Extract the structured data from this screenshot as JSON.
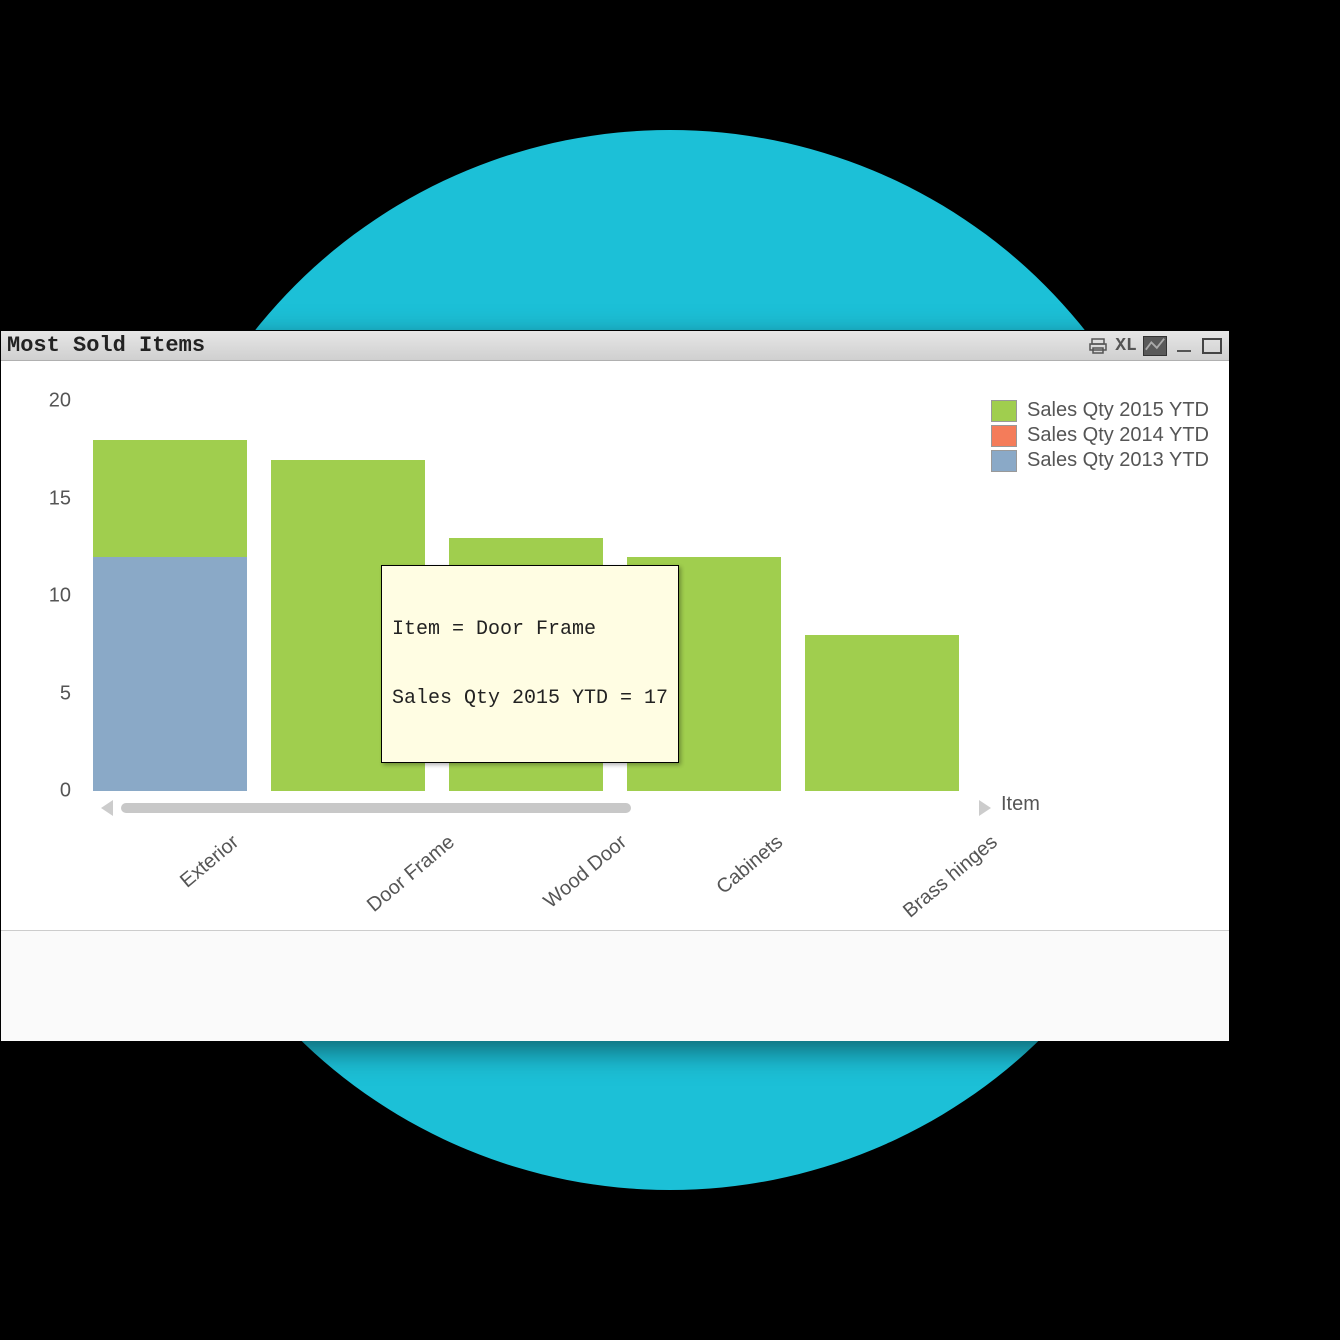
{
  "window": {
    "title": "Most Sold Items"
  },
  "toolbar_icons": [
    "print-icon",
    "xl-icon",
    "chart-type-icon",
    "minimize-icon",
    "maximize-icon"
  ],
  "xl_label": "XL",
  "axis": {
    "xlabel": "Item"
  },
  "y_ticks": [
    "0",
    "5",
    "10",
    "15",
    "20"
  ],
  "legend": {
    "items": [
      {
        "label": "Sales Qty 2015 YTD"
      },
      {
        "label": "Sales Qty 2014 YTD"
      },
      {
        "label": "Sales Qty 2013 YTD"
      }
    ]
  },
  "tooltip": {
    "line1": "Item = Door Frame",
    "line2": "Sales Qty 2015 YTD = 17"
  },
  "categories": [
    "Exterior",
    "Door Frame",
    "Wood Door",
    "Cabinets",
    "Brass hinges"
  ],
  "colors": {
    "s2015": "#a0ce4e",
    "s2014": "#f47c5a",
    "s2013": "#8aa9c7"
  },
  "chart_data": {
    "type": "bar",
    "title": "Most Sold Items",
    "xlabel": "Item",
    "ylabel": "",
    "ylim": [
      0,
      20
    ],
    "yticks": [
      0,
      5,
      10,
      15,
      20
    ],
    "categories": [
      "Exterior",
      "Door Frame",
      "Wood Door",
      "Cabinets",
      "Brass hinges"
    ],
    "stacked": true,
    "series": [
      {
        "name": "Sales Qty 2013 YTD",
        "color": "#8aa9c7",
        "values": [
          12,
          0,
          0,
          0,
          0
        ]
      },
      {
        "name": "Sales Qty 2014 YTD",
        "color": "#f47c5a",
        "values": [
          0,
          0,
          0,
          0,
          0
        ]
      },
      {
        "name": "Sales Qty 2015 YTD",
        "color": "#a0ce4e",
        "values": [
          6,
          17,
          13,
          12,
          8
        ]
      }
    ],
    "legend_position": "top-right",
    "grid": false,
    "tooltip_example": {
      "category": "Door Frame",
      "series": "Sales Qty 2015 YTD",
      "value": 17
    }
  }
}
